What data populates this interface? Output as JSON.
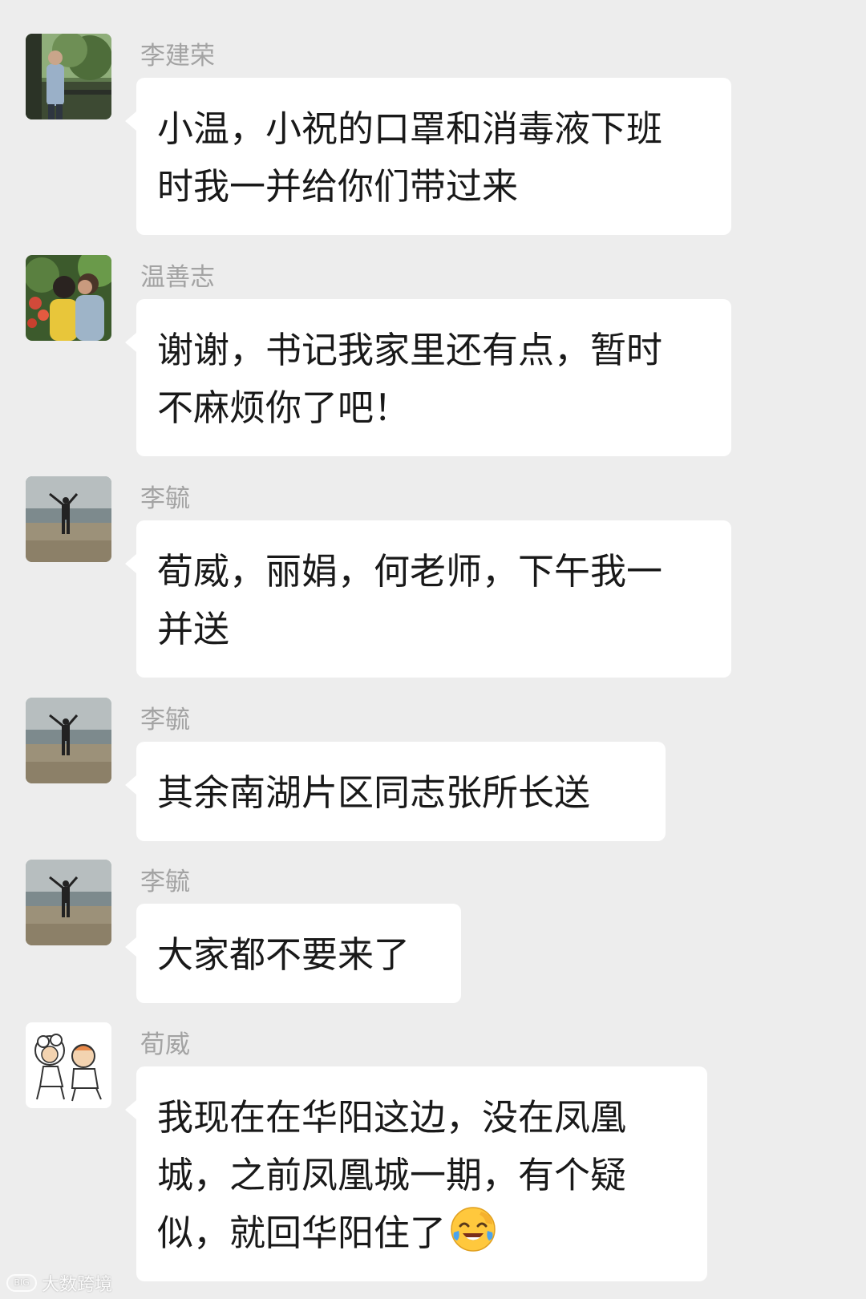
{
  "messages": [
    {
      "sender": "李建荣",
      "avatar": "landscape-photo-avatar",
      "lines": [
        "小温，小祝的口罩和消毒液下班",
        "时我一并给你们带过来"
      ]
    },
    {
      "sender": "温善志",
      "avatar": "couple-photo-avatar",
      "lines": [
        "谢谢，书记我家里还有点，暂时",
        "不麻烦你了吧！"
      ]
    },
    {
      "sender": "李毓",
      "avatar": "beach-photo-avatar",
      "lines": [
        "荀威，丽娟，何老师，下午我一",
        "并送"
      ]
    },
    {
      "sender": "李毓",
      "avatar": "beach-photo-avatar",
      "lines": [
        "其余南湖片区同志张所长送"
      ]
    },
    {
      "sender": "李毓",
      "avatar": "beach-photo-avatar",
      "lines": [
        "大家都不要来了"
      ]
    },
    {
      "sender": "荀威",
      "avatar": "cartoon-avatar",
      "lines": [
        "我现在在华阳这边，没在凤凰",
        "城，之前凤凰城一期，有个疑",
        "似，就回华阳住了"
      ],
      "trailing_emoji": "laughing-crying-emoji"
    }
  ],
  "watermark": {
    "text": "大数跨境",
    "logo_text": "BIG"
  },
  "colors": {
    "background": "#ededed",
    "bubble": "#ffffff",
    "sender_name": "#a3a3a3",
    "message_text": "#191919"
  }
}
